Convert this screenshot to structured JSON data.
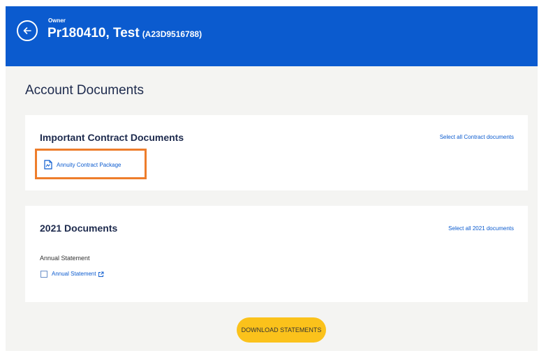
{
  "header": {
    "owner_label": "Owner",
    "owner_name": "Pr180410, Test",
    "owner_id": "(A23D9516788)",
    "color": "#0b5bcf"
  },
  "page": {
    "title": "Account Documents"
  },
  "contract_section": {
    "title": "Important Contract Documents",
    "select_all_label": "Select all Contract documents",
    "documents": [
      {
        "label": "Annuity Contract Package",
        "icon": "document-icon"
      }
    ],
    "highlight_color": "#ee7d2b"
  },
  "year_section": {
    "title": "2021 Documents",
    "select_all_label": "Select all 2021 documents",
    "group_label": "Annual Statement",
    "documents": [
      {
        "label": "Annual Statement",
        "icon": "external-link-icon",
        "checked": false
      }
    ]
  },
  "download": {
    "label": "DOWNLOAD STATEMENTS",
    "color": "#fbc21b"
  }
}
